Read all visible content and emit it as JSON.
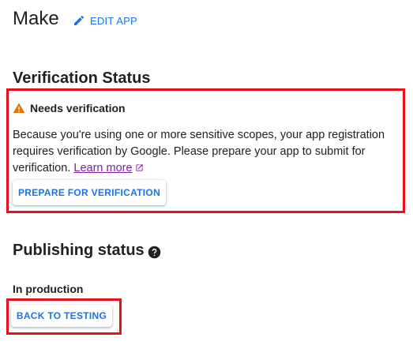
{
  "header": {
    "app_name": "Make",
    "edit_label": "EDIT APP",
    "edit_icon": "pencil-icon"
  },
  "verification": {
    "title": "Verification Status",
    "alert_title": "Needs verification",
    "alert_icon": "warning-icon",
    "alert_color": "#e37400",
    "body_text": "Because you're using one or more sensitive scopes, your app registration requires verification by Google. Please prepare your app to submit for verification.",
    "learn_more_label": "Learn more",
    "external_icon": "external-link-icon",
    "prepare_button": "PREPARE FOR VERIFICATION"
  },
  "publishing": {
    "title": "Publishing status",
    "help_icon": "help-circle-icon",
    "status": "In production",
    "back_button": "BACK TO TESTING"
  },
  "colors": {
    "accent": "#1a73e8",
    "highlight": "#e8101c",
    "link_visited": "#7b1fa2"
  }
}
